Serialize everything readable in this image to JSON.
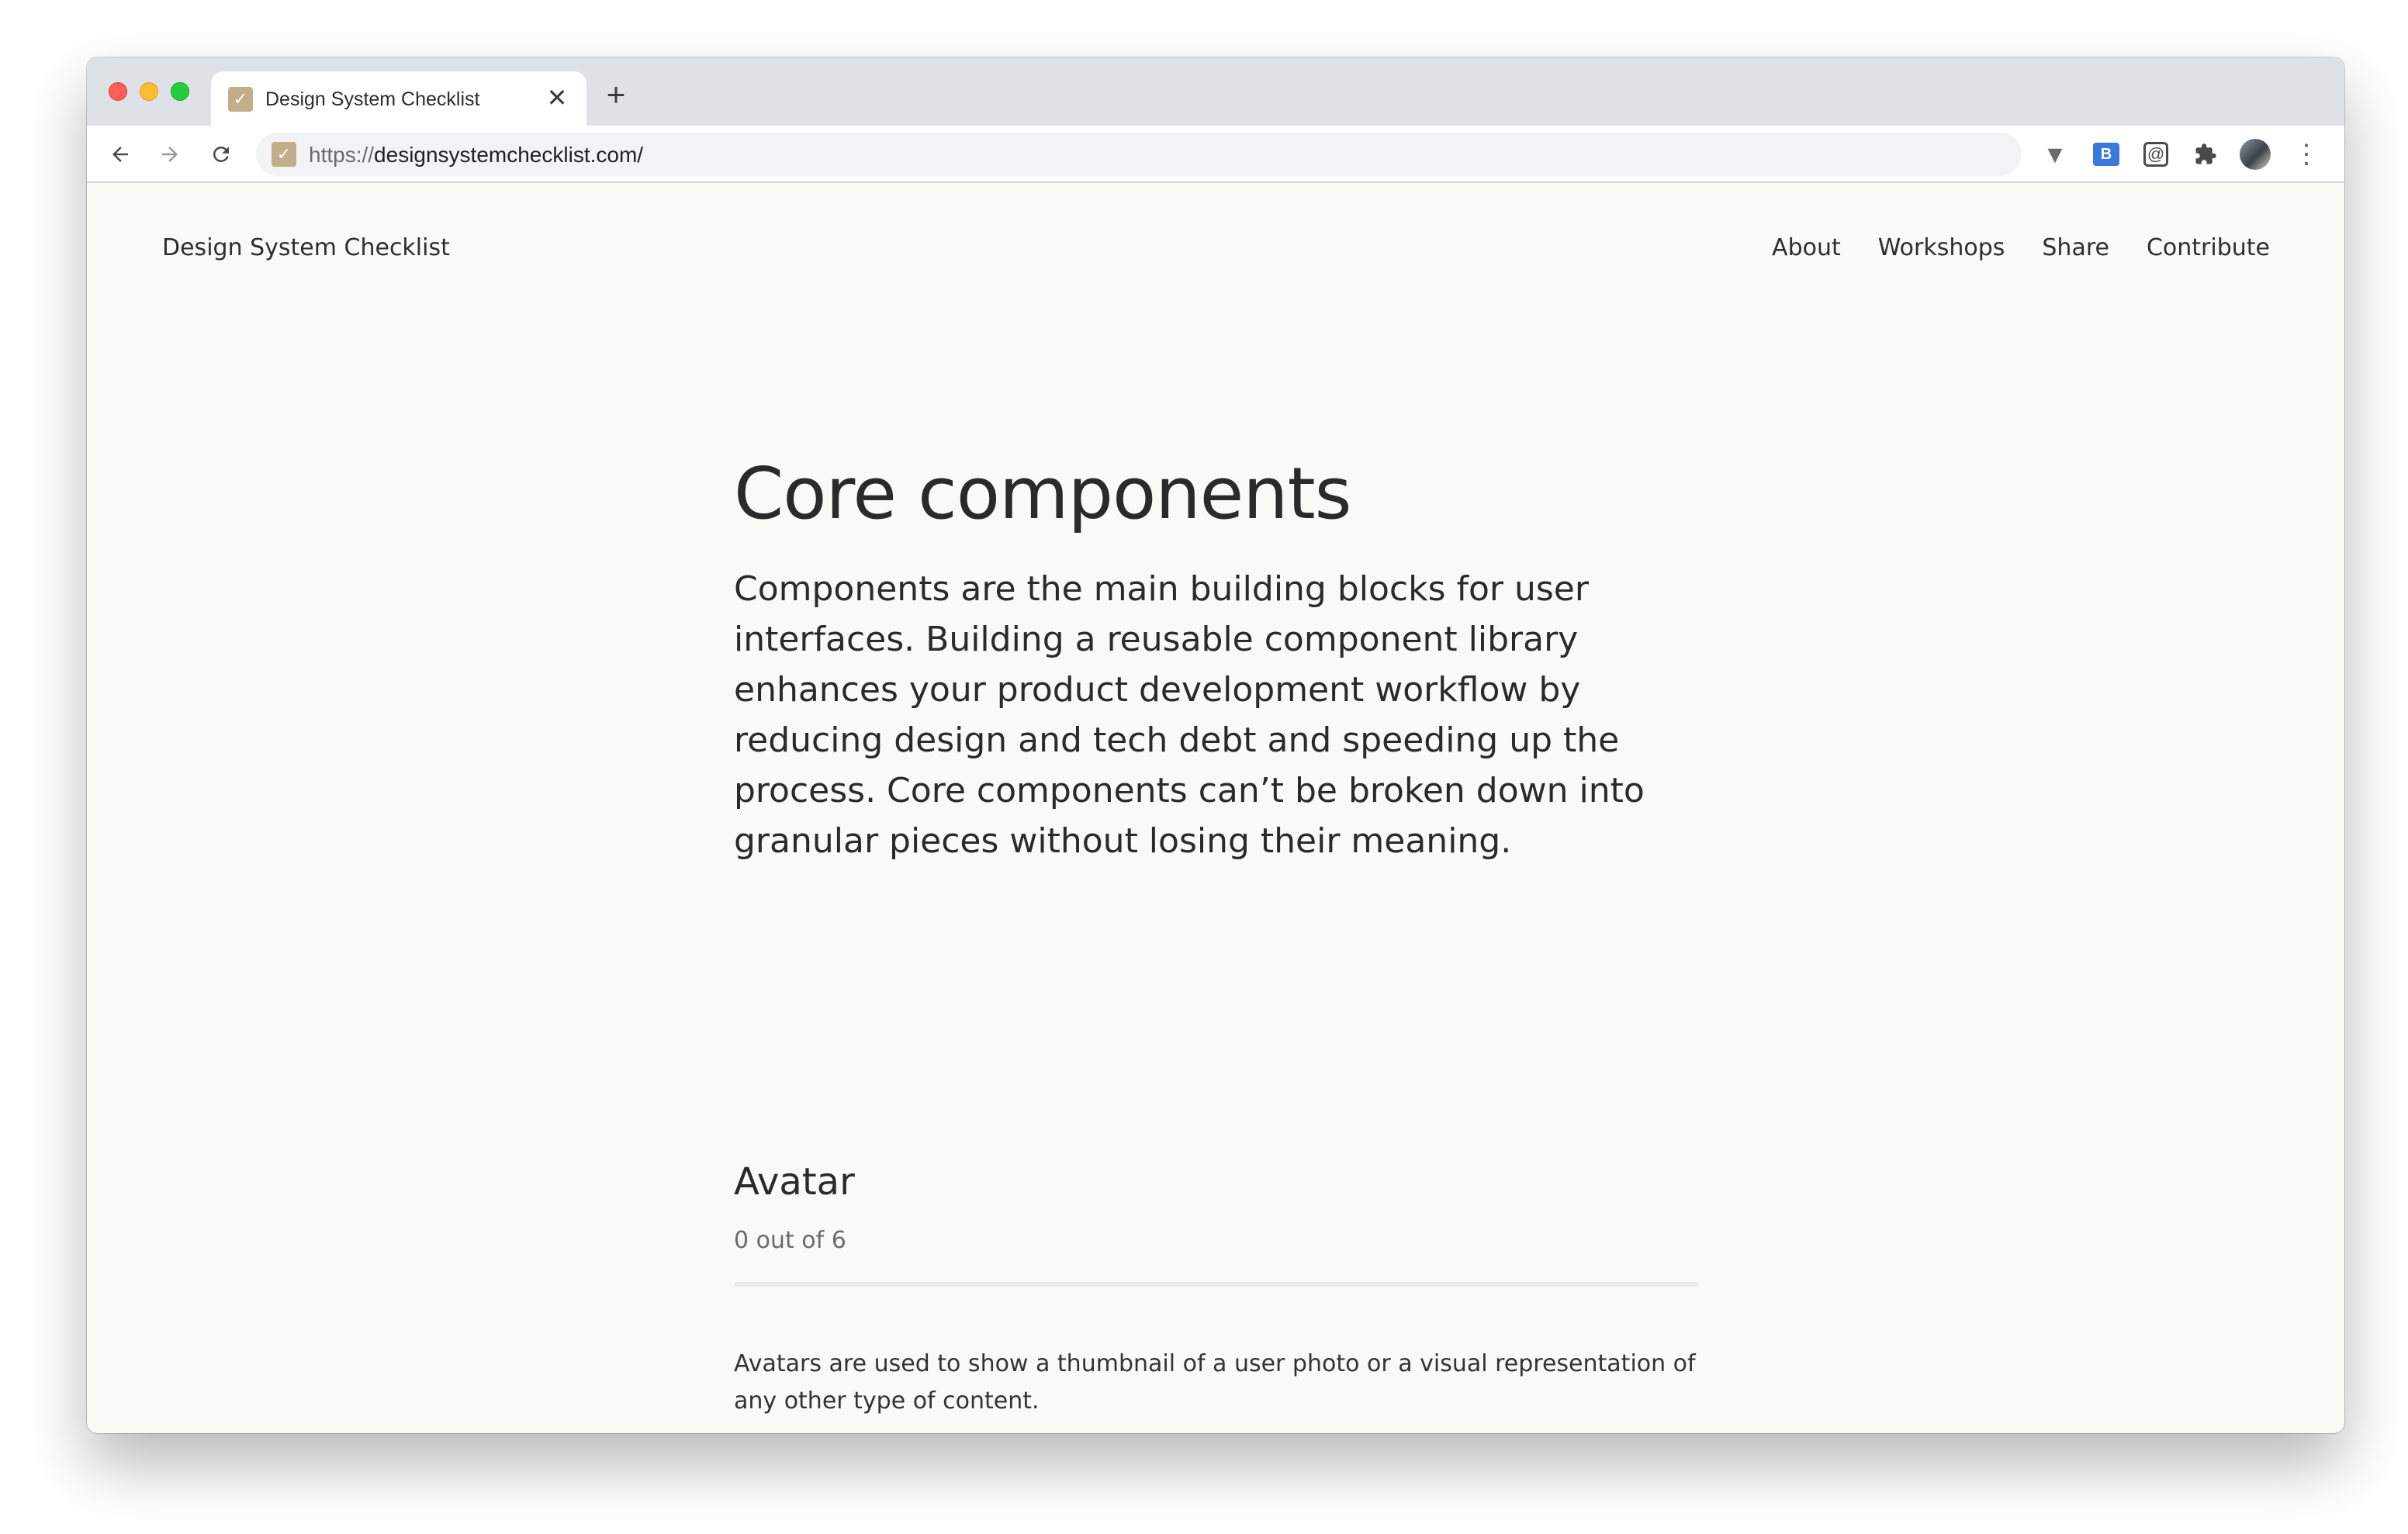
{
  "browser": {
    "tab": {
      "title": "Design System Checklist",
      "favicon": "check-icon",
      "close_glyph": "✕"
    },
    "new_tab_glyph": "+",
    "url": {
      "scheme": "https://",
      "host_path": "designsystemchecklist.com/"
    },
    "extensions": [
      "vimeo-icon",
      "bi-extension-icon",
      "at-extension-icon",
      "puzzle-icon",
      "profile-avatar",
      "kebab-menu-icon"
    ]
  },
  "site": {
    "title": "Design System Checklist",
    "nav": [
      {
        "label": "About"
      },
      {
        "label": "Workshops"
      },
      {
        "label": "Share"
      },
      {
        "label": "Contribute"
      }
    ]
  },
  "main": {
    "title": "Core components",
    "lead": "Components are the main building blocks for user interfaces. Building a reusable component library enhances your product development workflow by reducing design and tech debt and speeding up the process. Core components can’t be broken down into granular pieces without losing their meaning."
  },
  "section": {
    "title": "Avatar",
    "progress_text": "0 out of 6",
    "progress_fraction": 0,
    "description": "Avatars are used to show a thumbnail of a user photo or a visual representation of any other type of content."
  },
  "colors": {
    "accent": "#c3ae8c",
    "page_background": "#f9f9f5",
    "text": "#2e2e2e"
  }
}
